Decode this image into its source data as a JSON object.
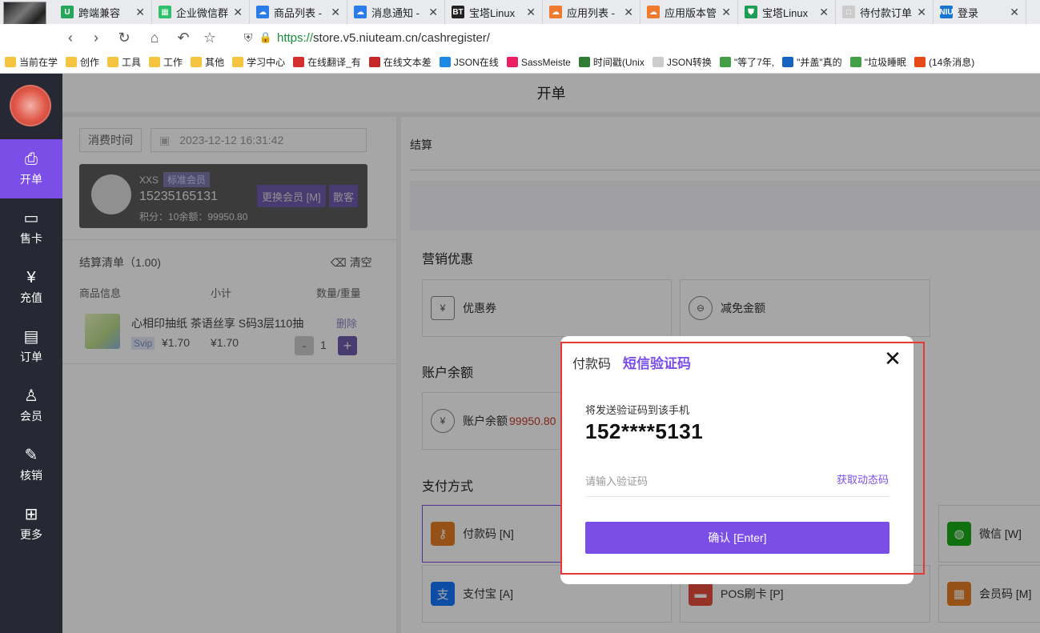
{
  "browser": {
    "tabs": [
      {
        "title": "跨端兼容",
        "color": "#26a65b",
        "glyph": "U"
      },
      {
        "title": "企业微信群",
        "color": "#2fbf6d",
        "glyph": "▦"
      },
      {
        "title": "商品列表 -",
        "color": "#2b7be8",
        "glyph": "☁"
      },
      {
        "title": "消息通知 -",
        "color": "#2b7be8",
        "glyph": "☁"
      },
      {
        "title": "宝塔Linux",
        "color": "#222222",
        "glyph": "BT"
      },
      {
        "title": "应用列表 -",
        "color": "#ef7a2e",
        "glyph": "☁"
      },
      {
        "title": "应用版本管",
        "color": "#ef7a2e",
        "glyph": "☁"
      },
      {
        "title": "宝塔Linux",
        "color": "#1e9e54",
        "glyph": "⛊"
      },
      {
        "title": "待付款订单",
        "color": "#cccccc",
        "glyph": "□"
      },
      {
        "title": "登录",
        "color": "#1876d2",
        "glyph": "NIU"
      }
    ],
    "url_scheme": "https://",
    "url_rest": "store.v5.niuteam.cn/cashregister/",
    "bookmarks": [
      {
        "label": "当前在学",
        "type": "folder"
      },
      {
        "label": "创作",
        "type": "folder"
      },
      {
        "label": "工具",
        "type": "folder"
      },
      {
        "label": "工作",
        "type": "folder"
      },
      {
        "label": "其他",
        "type": "folder"
      },
      {
        "label": "学习中心",
        "type": "folder"
      },
      {
        "label": "在线翻译_有",
        "type": "link",
        "color": "#d32f2f"
      },
      {
        "label": "在线文本差",
        "type": "link",
        "color": "#c62828"
      },
      {
        "label": "JSON在线",
        "type": "link",
        "color": "#1e88e5"
      },
      {
        "label": "SassMeiste",
        "type": "link",
        "color": "#e91e63"
      },
      {
        "label": "时间戳(Unix",
        "type": "link",
        "color": "#2e7d32"
      },
      {
        "label": "JSON转换",
        "type": "link",
        "color": "#cccccc"
      },
      {
        "label": "\"等了7年,",
        "type": "link",
        "color": "#43a047"
      },
      {
        "label": "\"并盖\"真的",
        "type": "link",
        "color": "#1565c0"
      },
      {
        "label": "\"垃圾睡眠",
        "type": "link",
        "color": "#43a047"
      },
      {
        "label": "(14条消息)",
        "type": "link",
        "color": "#e64a19"
      }
    ]
  },
  "sidebar": {
    "items": [
      {
        "label": "开单",
        "icon": "cashier-icon",
        "glyph": "⎙"
      },
      {
        "label": "售卡",
        "icon": "card-icon",
        "glyph": "▭"
      },
      {
        "label": "充值",
        "icon": "yuan-icon",
        "glyph": "¥"
      },
      {
        "label": "订单",
        "icon": "order-icon",
        "glyph": "▤"
      },
      {
        "label": "会员",
        "icon": "member-icon",
        "glyph": "♙"
      },
      {
        "label": "核销",
        "icon": "verify-icon",
        "glyph": "✎"
      },
      {
        "label": "更多",
        "icon": "more-icon",
        "glyph": "⊞"
      }
    ]
  },
  "header": {
    "title": "开单"
  },
  "left": {
    "time_label": "消费时间",
    "time_value": "2023-12-12 16:31:42",
    "member": {
      "name": "XXS",
      "level": "标准会员",
      "phone": "15235165131",
      "points_balance": "积分：10余额：99950.80",
      "change_button": "更换会员 [M]",
      "guest_button": "散客"
    },
    "settle_title": "结算清单（1.00)",
    "clear_label": "清空",
    "columns": [
      "商品信息",
      "小计",
      "数量/重量"
    ],
    "product": {
      "name": "心相印抽纸 茶语丝享 S码3层110抽",
      "tag": "Svip",
      "price": "¥1.70",
      "subtotal": "¥1.70",
      "delete": "删除",
      "quantity": "1",
      "minus": "-",
      "plus": "+"
    }
  },
  "right": {
    "title": "结算",
    "marketing_title": "营销优惠",
    "coupon": "优惠券",
    "discount": "减免金额",
    "balance_title": "账户余额",
    "balance_label": "账户余额",
    "balance_value": "99950.80",
    "payment_title": "支付方式",
    "payments": [
      {
        "label": "付款码 [N]",
        "color": "#e67e22"
      },
      {
        "label": "微信 [W]",
        "color": "#1aad19"
      },
      {
        "label": "支付宝 [A]",
        "color": "#1677ff"
      },
      {
        "label": "POS刷卡 [P]",
        "color": "#e74c3c"
      },
      {
        "label": "会员码 [M]",
        "color": "#e67e22"
      }
    ]
  },
  "modal": {
    "tab_paycode": "付款码",
    "tab_sms": "短信验证码",
    "hint": "将发送验证码到该手机",
    "phone": "152****5131",
    "input_placeholder": "请输入验证码",
    "get_code": "获取动态码",
    "confirm": "确认 [Enter]",
    "close": "✕"
  }
}
